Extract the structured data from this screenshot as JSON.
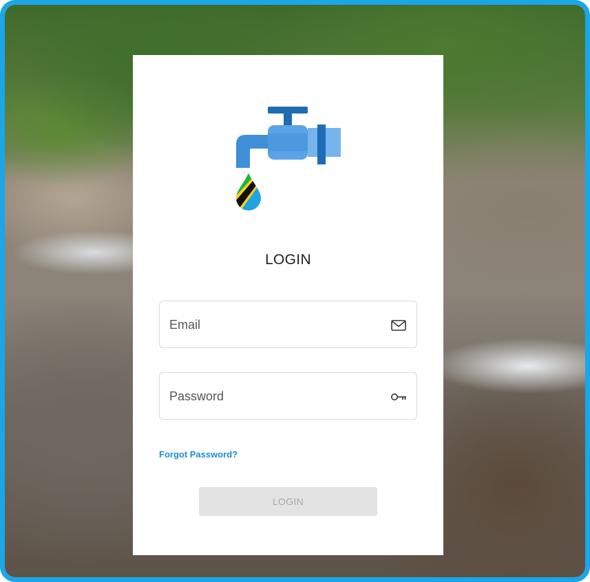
{
  "colors": {
    "frame": "#1ba6e8",
    "link": "#1a8fd6",
    "button_bg": "#e3e3e3",
    "button_text": "#a8a8a8",
    "tap": "#3f8fd9",
    "tap_dark": "#1d6cb5"
  },
  "logo": {
    "icon": "water-tap-with-tanzania-flag-drop-icon"
  },
  "form": {
    "title": "LOGIN",
    "email": {
      "placeholder": "Email",
      "icon": "envelope-icon"
    },
    "password": {
      "placeholder": "Password",
      "icon": "key-icon"
    },
    "forgot_password": "Forgot Password?",
    "submit_label": "LOGIN"
  }
}
